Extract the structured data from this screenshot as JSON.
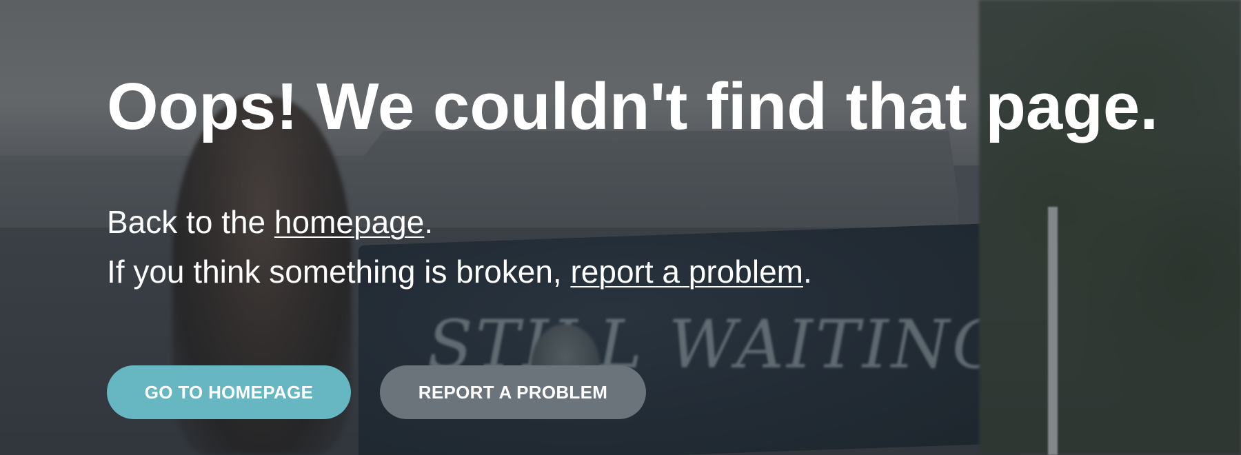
{
  "title": "Oops! We couldn't find that page.",
  "line1": {
    "prefix": "Back to the ",
    "link": "homepage",
    "suffix": "."
  },
  "line2": {
    "prefix": "If you think something is broken, ",
    "link": "report a problem",
    "suffix": "."
  },
  "buttons": {
    "primary": "GO TO HOMEPAGE",
    "secondary": "REPORT A PROBLEM"
  },
  "colors": {
    "primary_button": "#66b7c1",
    "secondary_button": "#6b737b",
    "text": "#ffffff"
  },
  "background": {
    "banner_text": "STILL WAITING"
  }
}
